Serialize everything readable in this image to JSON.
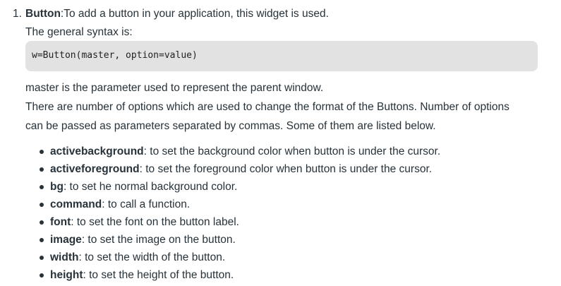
{
  "item": {
    "number": "1.",
    "title": "Button",
    "intro": ":To add a button in your application, this widget is used."
  },
  "syntax_heading": "The general syntax is:",
  "code": "w=Button(master, option=value)",
  "paragraphs": [
    "master is the parameter used to represent the parent window.",
    "There are number of options which are used to change the format of the Buttons. Number of options",
    "can be passed as parameters separated by commas. Some of them are listed below."
  ],
  "options": [
    {
      "name": "activebackground",
      "desc": ": to set the background color when button is under the cursor."
    },
    {
      "name": "activeforeground",
      "desc": ": to set the foreground color when button is under the cursor."
    },
    {
      "name": "bg",
      "desc": ": to set he normal background color."
    },
    {
      "name": "command",
      "desc": ": to call a function."
    },
    {
      "name": "font",
      "desc": ": to set the font on the button label."
    },
    {
      "name": "image",
      "desc": ": to set the image on the button."
    },
    {
      "name": "width",
      "desc": ": to set the width of the button."
    },
    {
      "name": "height",
      "desc": ": to set the height of the button."
    }
  ],
  "colors": {
    "text": "#273239",
    "code_background": "#e2e2e2"
  }
}
